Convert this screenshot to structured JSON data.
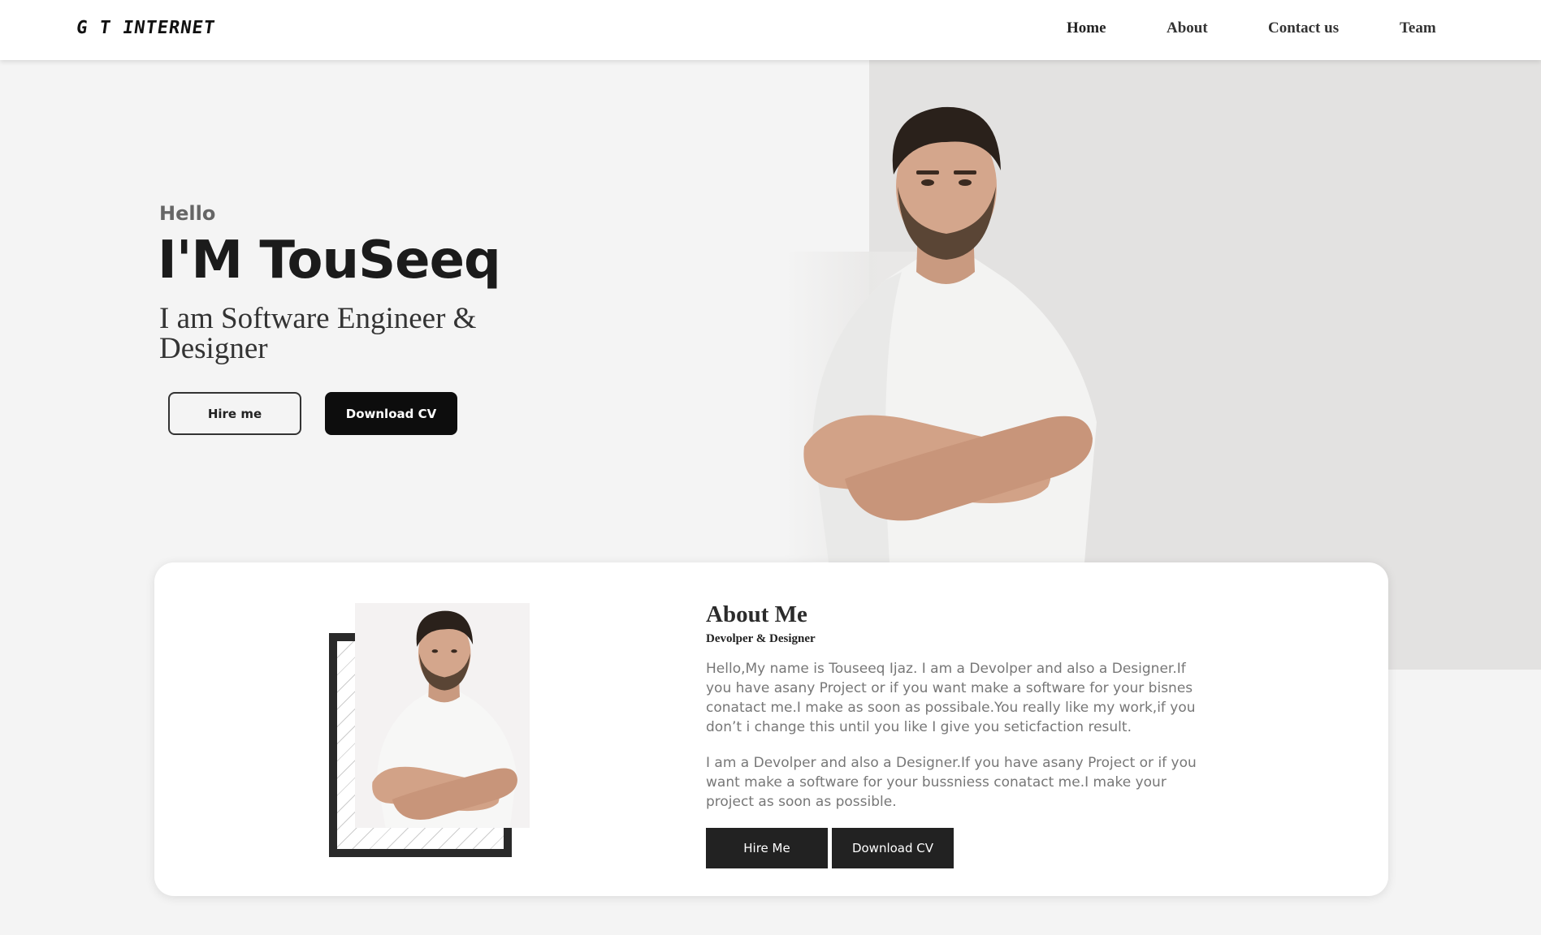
{
  "header": {
    "logo": "G T INTERNET",
    "nav": [
      {
        "label": "Home"
      },
      {
        "label": "About"
      },
      {
        "label": "Contact us"
      },
      {
        "label": "Team"
      }
    ]
  },
  "hero": {
    "greeting": "Hello",
    "name": "I'M TouSeeq",
    "subtitle": "I am Software Engineer & Designer",
    "hire_button": "Hire me",
    "cv_button": "Download CV"
  },
  "about": {
    "title": "About Me",
    "subtitle": "Devolper & Designer",
    "paragraph1": "Hello,My name is Touseeq Ijaz. I am a Devolper and also a Designer.If you have asany Project or if you want make a software for your bisnes conatact me.I make as soon as possibale.You really like my work,if you don’t i change this until you like I give you seticfaction result.",
    "paragraph2": "I am a Devolper and also a Designer.If you have asany Project or if you want make a software for your bussniess conatact me.I make your project as soon as possible.",
    "hire_button": "Hire Me",
    "cv_button": "Download CV"
  },
  "colors": {
    "background": "#f4f4f4",
    "hero_panel": "#e3e2e1",
    "dark": "#0d0d0d",
    "button_square": "#222222",
    "text_muted": "#777777"
  }
}
